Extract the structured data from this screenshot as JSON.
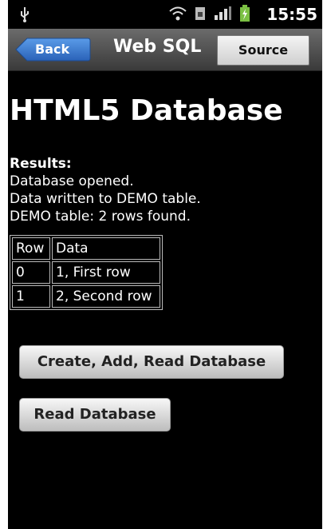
{
  "status_bar": {
    "time": "15:55",
    "icons": [
      "usb-icon",
      "wifi-icon",
      "sim-icon",
      "signal-icon",
      "battery-charging-icon"
    ]
  },
  "title_bar": {
    "back_label": "Back",
    "title": "Web SQL",
    "source_label": "Source"
  },
  "main": {
    "heading": "HTML5 Database",
    "results_label": "Results:",
    "messages": [
      "Database opened.",
      "Data written to DEMO table.",
      "DEMO table: 2 rows found."
    ],
    "table": {
      "headers": [
        "Row",
        "Data"
      ],
      "rows": [
        [
          "0",
          "1, First row"
        ],
        [
          "1",
          "2, Second row"
        ]
      ]
    },
    "buttons": {
      "create_add_read": "Create, Add, Read Database",
      "read": "Read Database"
    }
  },
  "colors": {
    "back_button": "#3d7fd6",
    "title_bar": "#555555",
    "background": "#000000"
  }
}
